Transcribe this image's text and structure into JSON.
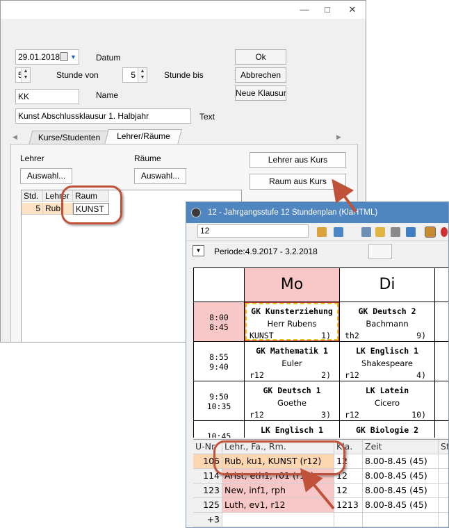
{
  "dialog": {
    "date": "29.01.2018",
    "date_label": "Datum",
    "hour_from": "5",
    "hour_from_label": "Stunde von",
    "hour_to": "5",
    "hour_to_label": "Stunde bis",
    "name_value": "KK",
    "name_label": "Name",
    "text_value": "Kunst Abschlussklausur 1. Halbjahr",
    "text_label": "Text",
    "buttons": {
      "ok": "Ok",
      "cancel": "Abbrechen",
      "new_exam": "Neue Klausur"
    },
    "tabs": [
      "Kurse/Studenten",
      "Lehrer/Räume"
    ],
    "teacher_label": "Lehrer",
    "rooms_label": "Räume",
    "select_teacher": "Auswahl...",
    "select_room": "Auswahl...",
    "teacher_from_course": "Lehrer aus Kurs",
    "room_from_course": "Raum aus Kurs",
    "grid": {
      "headers": [
        "Std.",
        "Lehrer",
        "Raum"
      ],
      "row": [
        "5",
        "Rub",
        "KUNST"
      ]
    },
    "window_icons": [
      "minimize-icon",
      "maximize-icon",
      "close-icon"
    ]
  },
  "timetable": {
    "title": "12 - Jahrgangsstufe 12  Stundenplan  (KlaHTML)",
    "class_value": "12",
    "period": "Periode:4.9.2017 - 3.2.2018",
    "days": [
      "Mo",
      "Di"
    ],
    "slots": [
      {
        "start": "8:00",
        "end": "8:45"
      },
      {
        "start": "8:55",
        "end": "9:40"
      },
      {
        "start": "9:50",
        "end": "10:35"
      },
      {
        "start": "10:45",
        "end": ""
      }
    ],
    "lessons": [
      {
        "subject": "GK Kunsterziehung",
        "teacher": "Herr Rubens",
        "room": "KUNST",
        "num": "1)"
      },
      {
        "subject": "GK Deutsch 2",
        "teacher": "Bachmann",
        "room": "th2",
        "num": "9)"
      },
      {
        "subject": "GK Mathematik 1",
        "teacher": "Euler",
        "room": "r12",
        "num": "2)"
      },
      {
        "subject": "LK Englisch 1",
        "teacher": "Shakespeare",
        "room": "r12",
        "num": "4)"
      },
      {
        "subject": "GK Deutsch 1",
        "teacher": "Goethe",
        "room": "r12",
        "num": "3)"
      },
      {
        "subject": "LK Latein",
        "teacher": "Cicero",
        "room": "r12",
        "num": "10)"
      },
      {
        "subject": "LK Englisch 1",
        "teacher": "",
        "room": "",
        "num": ""
      },
      {
        "subject": "GK Biologie 2",
        "teacher": "",
        "room": "",
        "num": ""
      }
    ],
    "grid": {
      "headers": [
        "U-Nr",
        "Lehr., Fa., Rm.",
        "Kla.",
        "Zeit",
        "St"
      ],
      "rows": [
        {
          "unr": "106",
          "info": "Rub, ku1, KUNST (r12)",
          "kla": "12",
          "time": "8.00-8.45 (45)"
        },
        {
          "unr": "114",
          "info": "Arist, eth1, r01 (r12)",
          "kla": "12",
          "time": "8.00-8.45 (45)"
        },
        {
          "unr": "123",
          "info": "New, inf1, rph",
          "kla": "12",
          "time": "8.00-8.45 (45)"
        },
        {
          "unr": "125",
          "info": "Luth, ev1, r12",
          "kla": "1213",
          "time": "8.00-8.45 (45)"
        },
        {
          "unr": "+3",
          "info": "",
          "kla": "",
          "time": ""
        }
      ]
    }
  },
  "colors": {
    "accent_callout": "#c0523a",
    "lesson_highlight": "#f8c8c8",
    "row_selected": "#fbd6b0",
    "titlebar": "#4f86c0"
  }
}
